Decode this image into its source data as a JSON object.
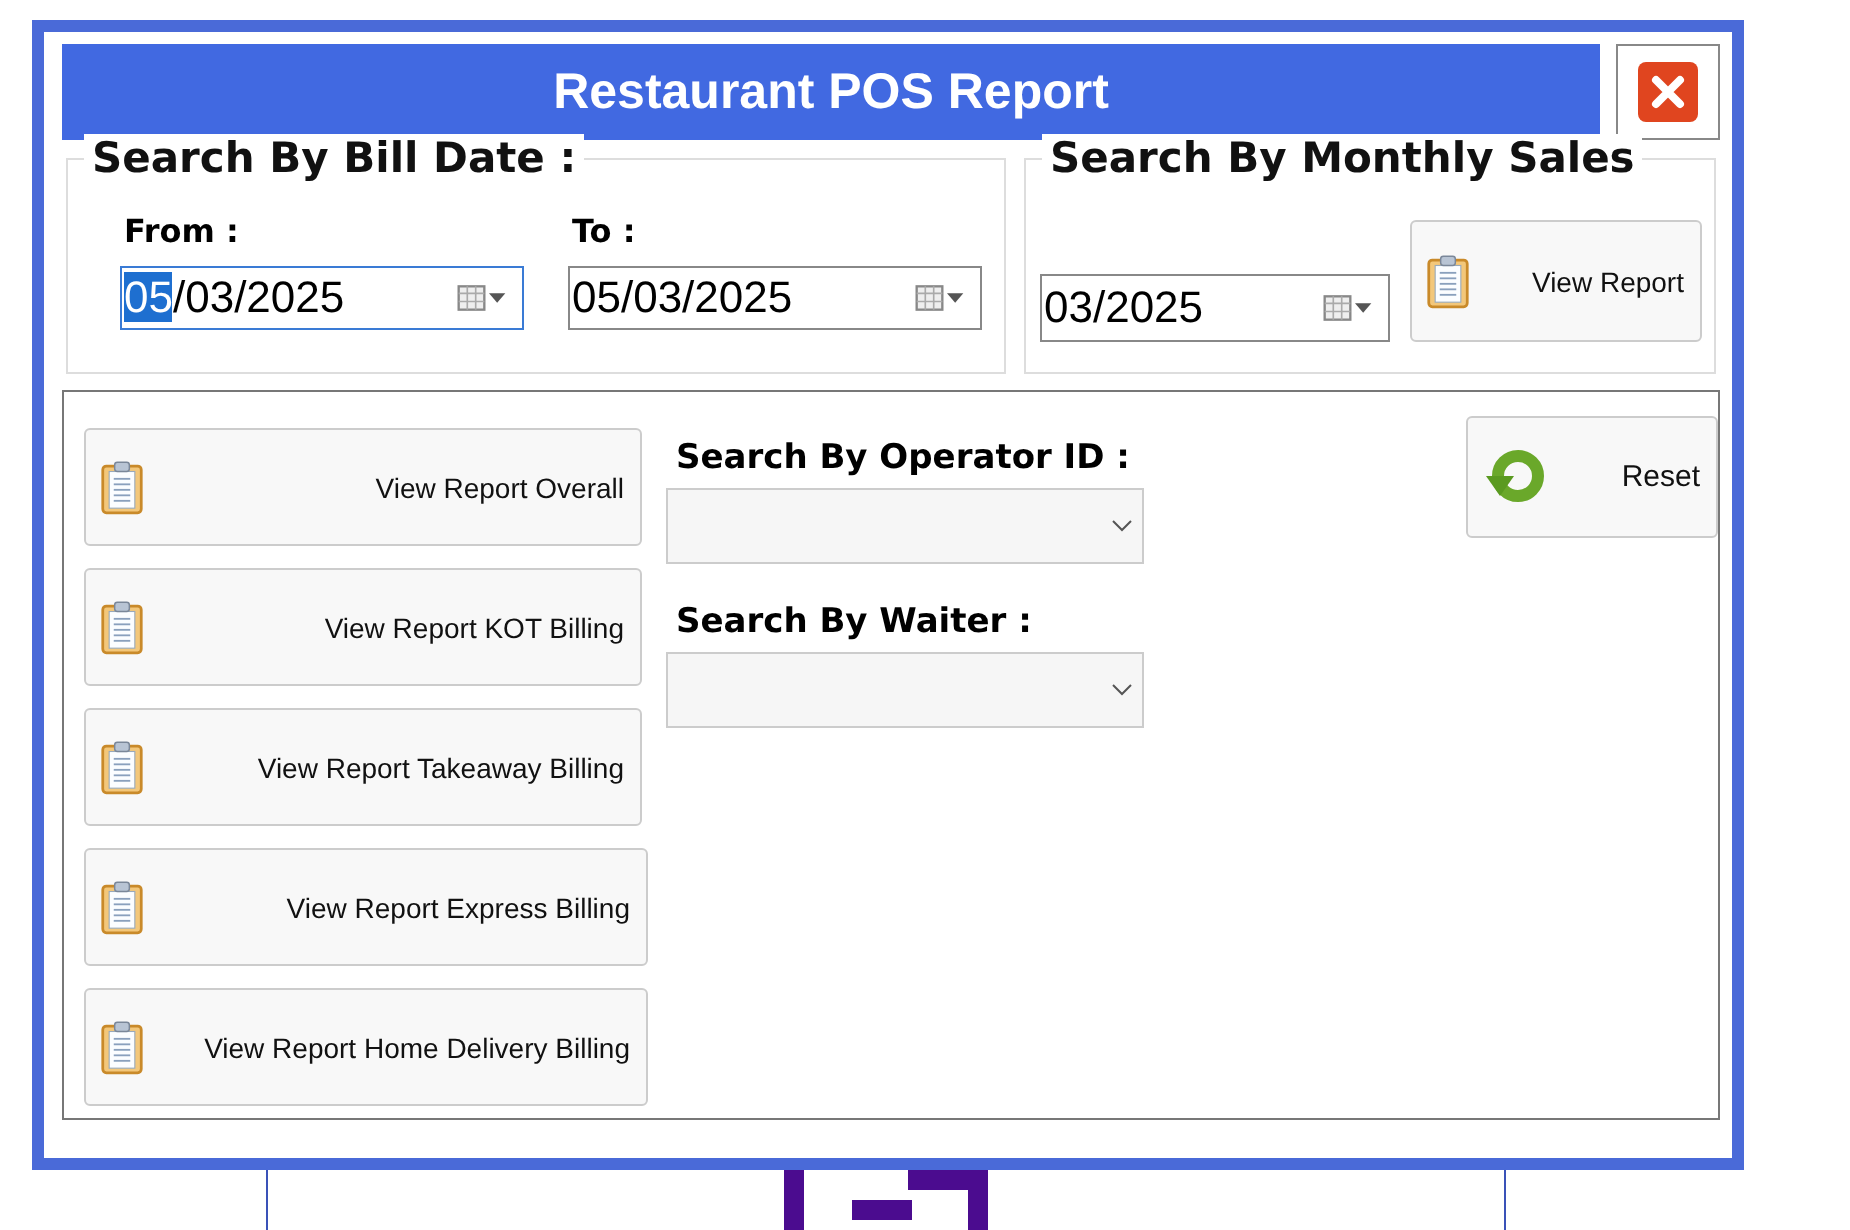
{
  "window": {
    "title": "Restaurant POS Report"
  },
  "bill_date": {
    "title": "Search By Bill Date :",
    "fields": [
      {
        "label": "From :",
        "value": "05/03/2025",
        "focused": true
      },
      {
        "label": "To :",
        "value": "05/03/2025",
        "focused": false
      }
    ]
  },
  "monthly_sales": {
    "title": "Search By Monthly Sales",
    "value": "03/2025",
    "button": "View Report"
  },
  "report_buttons": [
    "View Report Overall",
    "View Report KOT Billing",
    "View Report Takeaway Billing",
    "View Report Express Billing",
    "View Report Home Delivery Billing"
  ],
  "filters": [
    {
      "label": "Search By Operator ID :"
    },
    {
      "label": "Search By Waiter :"
    }
  ],
  "reset_button": "Reset"
}
